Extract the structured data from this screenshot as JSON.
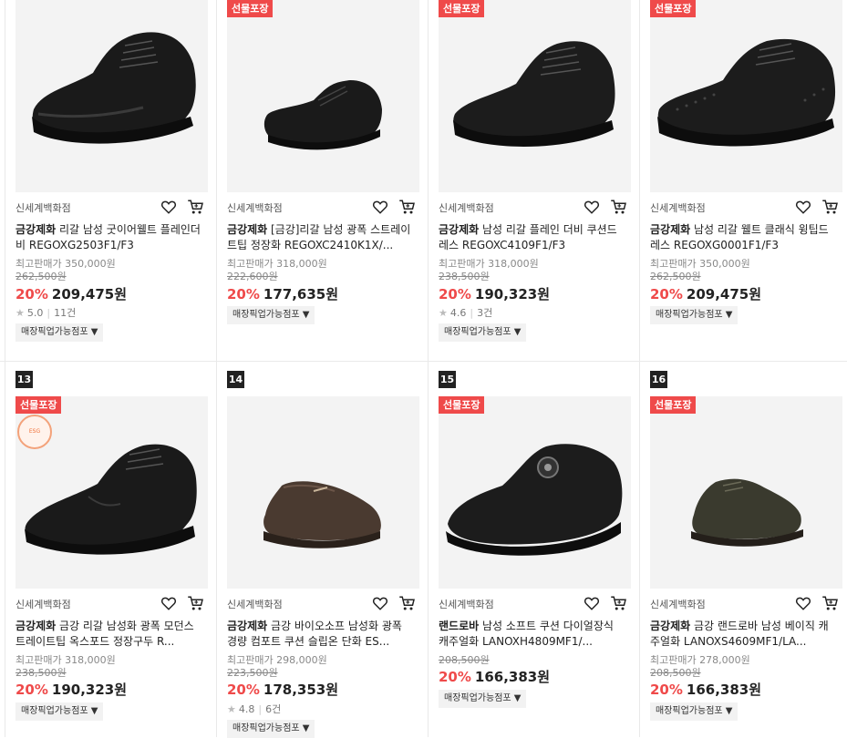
{
  "products": [
    {
      "rank": "",
      "gift": "",
      "store": "신세계백화점",
      "brand": "금강제화",
      "name": " 리갈 남성 굿이어웰트 플레인더비 REGOXG2503F1/F3",
      "max_price": "최고판매가 350,000원",
      "orig_price": "262,500원",
      "discount": "20%",
      "price": "209,475원",
      "rating": "5.0",
      "reviews": "11건",
      "pickup": "매장픽업가능점포 ▼"
    },
    {
      "rank": "",
      "gift": "선물포장",
      "store": "신세계백화점",
      "brand": "금강제화",
      "name": " [금강]리갈 남성 광폭 스트레이트팁 정장화 REGOXC2410K1X/...",
      "max_price": "최고판매가 318,000원",
      "orig_price": "222,600원",
      "discount": "20%",
      "price": "177,635원",
      "rating": "",
      "reviews": "",
      "pickup": "매장픽업가능점포 ▼"
    },
    {
      "rank": "",
      "gift": "선물포장",
      "store": "신세계백화점",
      "brand": "금강제화",
      "name": " 남성 리갈 플레인 더비 쿠션드레스 REGOXC4109F1/F3",
      "max_price": "최고판매가 318,000원",
      "orig_price": "238,500원",
      "discount": "20%",
      "price": "190,323원",
      "rating": "4.6",
      "reviews": "3건",
      "pickup": "매장픽업가능점포 ▼"
    },
    {
      "rank": "",
      "gift": "선물포장",
      "store": "신세계백화점",
      "brand": "금강제화",
      "name": " 남성 리갈 웰트 클래식 윙팁드레스 REGOXG0001F1/F3",
      "max_price": "최고판매가 350,000원",
      "orig_price": "262,500원",
      "discount": "20%",
      "price": "209,475원",
      "rating": "",
      "reviews": "",
      "pickup": "매장픽업가능점포 ▼"
    },
    {
      "rank": "13",
      "gift": "선물포장",
      "stamp": "ESG",
      "store": "신세계백화점",
      "brand": "금강제화",
      "name": " 금강 리갈 남성화 광폭 모던스트레이트팁 옥스포드 정장구두 R...",
      "max_price": "최고판매가 318,000원",
      "orig_price": "238,500원",
      "discount": "20%",
      "price": "190,323원",
      "rating": "",
      "reviews": "",
      "pickup": "매장픽업가능점포 ▼"
    },
    {
      "rank": "14",
      "gift": "",
      "store": "신세계백화점",
      "brand": "금강제화",
      "name": " 금강 바이오소프 남성화 광폭 경량 컴포트 쿠션 슬립온 단화 ES...",
      "max_price": "최고판매가 298,000원",
      "orig_price": "223,500원",
      "discount": "20%",
      "price": "178,353원",
      "rating": "4.8",
      "reviews": "6건",
      "pickup": "매장픽업가능점포 ▼"
    },
    {
      "rank": "15",
      "gift": "선물포장",
      "store": "신세계백화점",
      "brand": "랜드로바",
      "name": " 남성 소프트 쿠션 다이얼장식 캐주얼화 LANOXH4809MF1/...",
      "max_price": "",
      "orig_price": "208,500원",
      "discount": "20%",
      "price": "166,383원",
      "rating": "",
      "reviews": "",
      "pickup": "매장픽업가능점포 ▼"
    },
    {
      "rank": "16",
      "gift": "선물포장",
      "store": "신세계백화점",
      "brand": "금강제화",
      "name": " 금강 랜드로바 남성 베이직 캐주얼화 LANOXS4609MF1/LA...",
      "max_price": "최고판매가 278,000원",
      "orig_price": "208,500원",
      "discount": "20%",
      "price": "166,383원",
      "rating": "",
      "reviews": "",
      "pickup": "매장픽업가능점포 ▼"
    }
  ],
  "icons": {
    "wishlist": "heart-icon",
    "cart": "cart-icon",
    "star": "star-icon"
  },
  "colors": {
    "discount": "#ef4a4a",
    "gift_badge": "#ef4a4a",
    "rank_badge": "#222222",
    "image_bg": "#f3f3f3"
  }
}
